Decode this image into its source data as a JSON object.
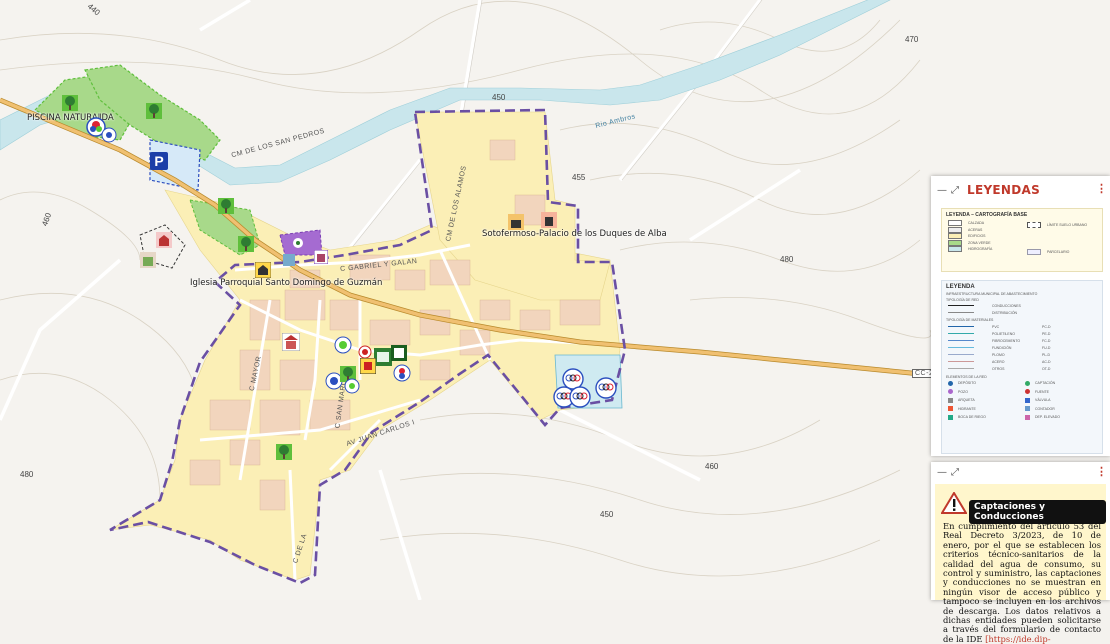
{
  "map": {
    "places": {
      "piscina": "PISCINA NATURAL",
      "piscina_tail": "IDA",
      "palacio": "Sotofermoso-Palacio de los Duques de Alba",
      "iglesia": "Iglesia Parroquial Santo Domingo de Guzmán"
    },
    "roads": {
      "cm_san_pedro": "CM DE LOS SAN PEDROS",
      "rio": "Rio Ambros",
      "cm_alamos": "CM DE LOS ALAMOS",
      "gabriel_galan": "C GABRIEL Y GALAN",
      "c_mayor": "C MAYOR",
      "cc_route": "CC-2",
      "c_san_marcos": "C SAN MARCOS",
      "c_juan_carlos": "AV JUAN CARLOS I",
      "c_de_la": "C DE LA"
    },
    "contours": [
      "440",
      "450",
      "455",
      "460",
      "460",
      "470",
      "480",
      "450",
      "480"
    ],
    "parking_icon": "parking-icon"
  },
  "legend_panel": {
    "title": "LEYENDAS",
    "minimize": "—",
    "expand": "⤢",
    "menu": "⋮",
    "box1": {
      "heading": "LEYENDA – CARTOGRAFÍA BASE",
      "items": [
        "CALZADA",
        "ACERAS",
        "EDIFICIOS",
        "ZONA VERDE",
        "HIDROGRAFÍA"
      ],
      "right_items": [
        "LÍMITE SUELO URBANO",
        "PARCELARIO"
      ]
    },
    "box2": {
      "heading": "LEYENDA",
      "subheading": "INFRAESTRUCTURA MUNICIPAL DE ABASTECIMIENTO",
      "tipo_red": "TIPOLOGÍA DE RED",
      "red_items": [
        "CONDUCCIONES",
        "DISTRIBUCIÓN"
      ],
      "material_heading": "TIPOLOGÍA DE MATERIALES",
      "materials": [
        {
          "name": "PVC",
          "code": "PC-D"
        },
        {
          "name": "POLIETILENO",
          "code": "PE-D"
        },
        {
          "name": "FIBROCEMENTO",
          "code": "FC-D"
        },
        {
          "name": "FUNDICIÓN",
          "code": "FU-D"
        },
        {
          "name": "PLOMO",
          "code": "PL-D"
        },
        {
          "name": "ACERO",
          "code": "AC-D"
        },
        {
          "name": "OTROS",
          "code": "OT-D"
        }
      ],
      "elements_heading": "ELEMENTOS DE LA RED",
      "elements": [
        "DEPÓSITO",
        "CAPTACIÓN",
        "POZO",
        "FUENTE",
        "ARQUETA",
        "VÁLVULA",
        "HIDRANTE",
        "CONTADOR",
        "BOCA DE RIEGO",
        "DEP. ELEVADO"
      ]
    }
  },
  "capt_panel": {
    "minimize": "—",
    "expand": "⤢",
    "menu": "⋮",
    "title": "Captaciones y Conducciones",
    "text": "En cumplimiento del artículo 53 del Real Decreto 3/2023, de 10 de enero, por el que se establecen los criterios técnico-sanitarios de la calidad del agua de consumo, su control y suministro, las captaciones y conducciones no se muestran en ningún visor de acceso público y tampoco se incluyen en los archivos de descarga. Los datos relativos a dichas entidades pueden solicitarse a través del formulario de contacto de la IDE",
    "link": "[https://ide.dip-"
  },
  "colors": {
    "urban": "#fbefb6",
    "boundary": "#6a4fa3",
    "green": "#a8d98a",
    "river": "#c8e6ec",
    "road_main": "#e1a84a",
    "accent": "#c0392b"
  }
}
